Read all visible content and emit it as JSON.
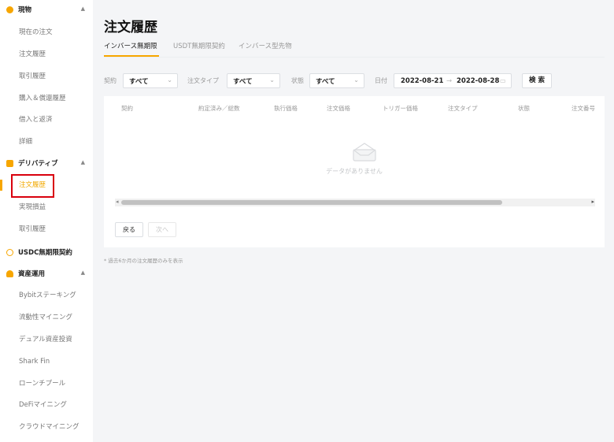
{
  "sidebar": {
    "sections": [
      {
        "title": "現物",
        "color": "#f7a600",
        "items": [
          "現在の注文",
          "注文履歴",
          "取引履歴",
          "購入＆償還履歴",
          "借入と返済",
          "詳細"
        ]
      },
      {
        "title": "デリバティブ",
        "color": "#f7a600",
        "items": [
          "注文履歴",
          "実現損益",
          "取引履歴"
        ]
      },
      {
        "title": "USDC無期限契約",
        "color": "#f7a600",
        "items": []
      },
      {
        "title": "資産運用",
        "color": "#f7a600",
        "items": [
          "Bybitステーキング",
          "流動性マイニング",
          "デュアル資産投資",
          "Shark Fin",
          "ローンチプール",
          "DeFiマイニング",
          "クラウドマイニング"
        ]
      }
    ],
    "active_item": "デリバティブ / 注文履歴"
  },
  "page": {
    "title": "注文履歴",
    "tabs": [
      "インバース無期限",
      "USDT無期限契約",
      "インバース型先物"
    ],
    "active_tab": "インバース無期限"
  },
  "filters": {
    "contract_label": "契約",
    "contract_value": "すべて",
    "order_type_label": "注文タイプ",
    "order_type_value": "すべて",
    "status_label": "状態",
    "status_value": "すべて",
    "date_label": "日付",
    "date_from": "2022-08-21",
    "date_to": "2022-08-28",
    "search_label": "検 索"
  },
  "table": {
    "columns": [
      "契約",
      "約定済み／総数",
      "執行価格",
      "注文価格",
      "トリガー価格",
      "注文タイプ",
      "状態",
      "注文番号"
    ],
    "empty_text": "データがありません"
  },
  "pagination": {
    "back_label": "戻る",
    "next_label": "次へ"
  },
  "footnote": "* 過去6か月の注文履歴のみを表示",
  "colors": {
    "accent": "#f7a600",
    "highlight_box": "#d9000d"
  }
}
